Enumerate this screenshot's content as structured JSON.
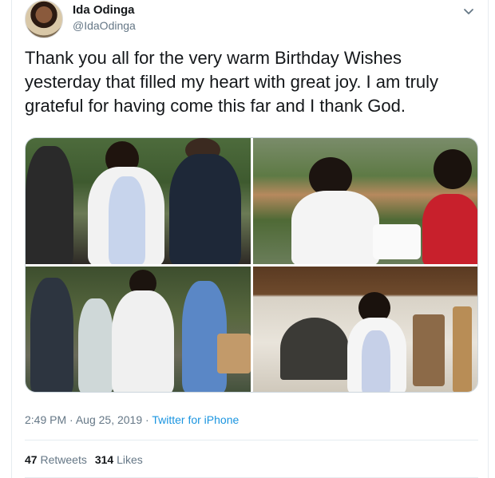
{
  "user": {
    "name": "Ida Odinga",
    "handle": "@IdaOdinga"
  },
  "tweet": {
    "text": "Thank you all for the very warm Birthday Wishes yesterday that filled my heart with great joy. I am truly grateful for having come this far and I thank God.",
    "time": "2:49 PM",
    "date": "Aug 25, 2019",
    "source": "Twitter for iPhone",
    "separator": "·"
  },
  "stats": {
    "retweets_count": "47",
    "retweets_label": "Retweets",
    "likes_count": "314",
    "likes_label": "Likes"
  },
  "photos": [
    {
      "icon": "photo-group-outdoors"
    },
    {
      "icon": "photo-birthday-cake"
    },
    {
      "icon": "photo-crowd-walking"
    },
    {
      "icon": "photo-house-entrance"
    }
  ],
  "colors": {
    "link": "#1b95e0",
    "muted": "#657786",
    "text": "#14171a",
    "border": "#e6ecf0"
  }
}
